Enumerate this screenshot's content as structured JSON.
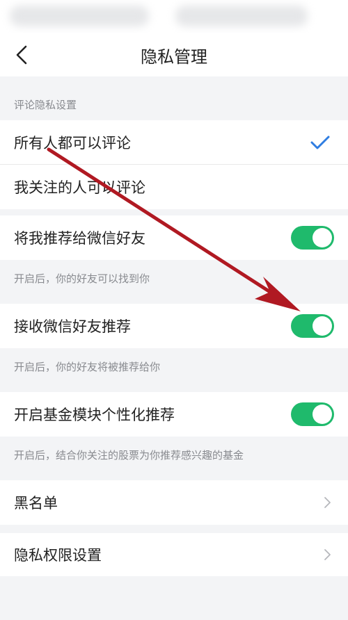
{
  "nav": {
    "title": "隐私管理",
    "back_icon": "chevron-left-icon"
  },
  "comment_privacy": {
    "section_label": "评论隐私设置",
    "options": [
      {
        "label": "所有人都可以评论",
        "selected": true
      },
      {
        "label": "我关注的人可以评论",
        "selected": false
      }
    ]
  },
  "toggles": [
    {
      "label": "将我推荐给微信好友",
      "on": true,
      "hint": "开启后，你的好友可以找到你"
    },
    {
      "label": "接收微信好友推荐",
      "on": true,
      "hint": "开启后，你的好友将被推荐给你"
    },
    {
      "label": "开启基金模块个性化推荐",
      "on": true,
      "hint": "开启后，结合你关注的股票为你推荐感兴趣的基金"
    }
  ],
  "links": [
    {
      "label": "黑名单"
    },
    {
      "label": "隐私权限设置"
    }
  ],
  "colors": {
    "toggle_on": "#1fba6c",
    "check": "#2f7de1",
    "annotation_arrow": "#b01922"
  }
}
